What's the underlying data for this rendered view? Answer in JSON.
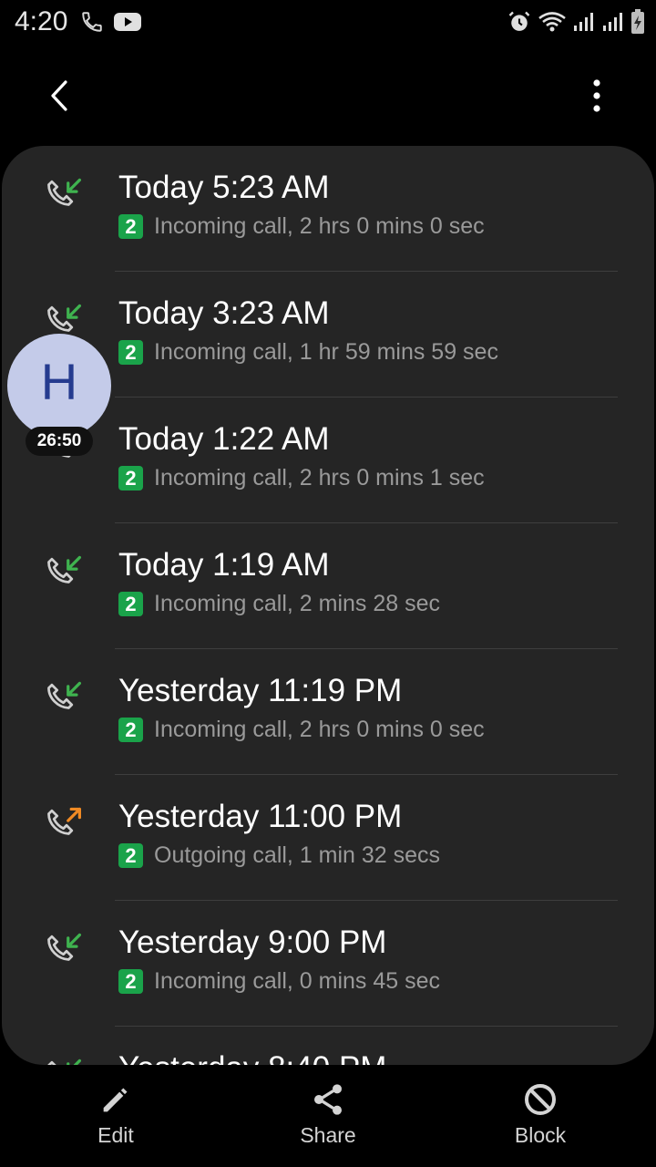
{
  "status_bar": {
    "time": "4:20",
    "left_icons": [
      "phone-icon",
      "youtube-icon"
    ],
    "right_icons": [
      "alarm-icon",
      "wifi-icon",
      "signal-icon",
      "signal-icon",
      "battery-charging-icon"
    ]
  },
  "app_bar": {
    "back_icon": "back-arrow-icon",
    "more_icon": "more-vertical-icon"
  },
  "call_log": [
    {
      "time": "Today 5:23 AM",
      "sim": "2",
      "detail": "Incoming call, 2 hrs 0 mins 0 sec",
      "type": "incoming"
    },
    {
      "time": "Today 3:23 AM",
      "sim": "2",
      "detail": "Incoming call, 1 hr 59 mins 59 sec",
      "type": "incoming"
    },
    {
      "time": "Today 1:22 AM",
      "sim": "2",
      "detail": "Incoming call, 2 hrs 0 mins 1 sec",
      "type": "incoming"
    },
    {
      "time": "Today 1:19 AM",
      "sim": "2",
      "detail": "Incoming call, 2 mins 28 sec",
      "type": "incoming"
    },
    {
      "time": "Yesterday 11:19 PM",
      "sim": "2",
      "detail": "Incoming call, 2 hrs 0 mins 0 sec",
      "type": "incoming"
    },
    {
      "time": "Yesterday 11:00 PM",
      "sim": "2",
      "detail": "Outgoing call, 1 min 32 secs",
      "type": "outgoing"
    },
    {
      "time": "Yesterday 9:00 PM",
      "sim": "2",
      "detail": "Incoming call, 0 mins 45 sec",
      "type": "incoming"
    },
    {
      "time": "Yesterday 8:40 PM",
      "sim": "",
      "detail": "",
      "type": "incoming"
    }
  ],
  "bubble": {
    "letter": "H",
    "timer": "26:50"
  },
  "actions": {
    "edit": "Edit",
    "share": "Share",
    "block": "Block"
  },
  "colors": {
    "incoming_arrow": "#3fb34f",
    "outgoing_arrow": "#f08a24",
    "sim_badge": "#1aa34a",
    "card_bg": "#252525"
  }
}
